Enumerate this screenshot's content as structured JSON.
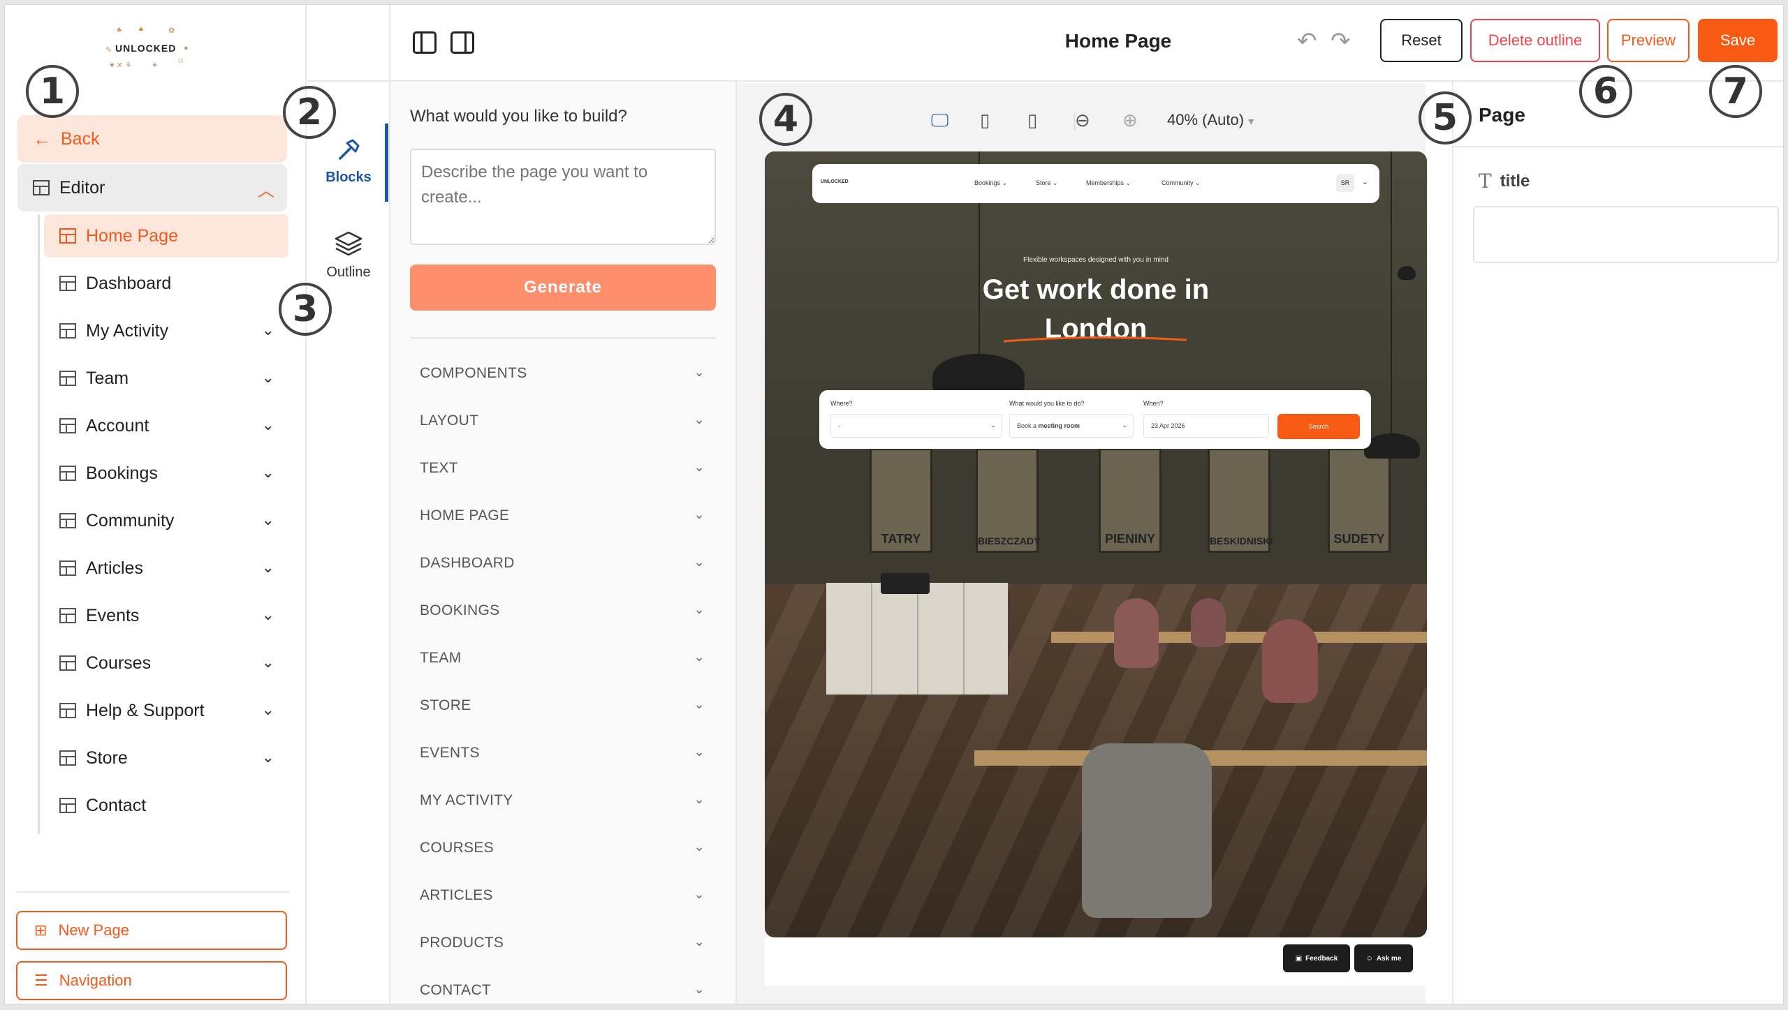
{
  "logo": {
    "text": "UNLOCKED"
  },
  "sidebar": {
    "back_label": "Back",
    "editor_label": "Editor",
    "items": [
      {
        "label": "Home Page",
        "active": true,
        "expandable": false
      },
      {
        "label": "Dashboard",
        "active": false,
        "expandable": false
      },
      {
        "label": "My Activity",
        "active": false,
        "expandable": true
      },
      {
        "label": "Team",
        "active": false,
        "expandable": true
      },
      {
        "label": "Account",
        "active": false,
        "expandable": true
      },
      {
        "label": "Bookings",
        "active": false,
        "expandable": true
      },
      {
        "label": "Community",
        "active": false,
        "expandable": true
      },
      {
        "label": "Articles",
        "active": false,
        "expandable": true
      },
      {
        "label": "Events",
        "active": false,
        "expandable": true
      },
      {
        "label": "Courses",
        "active": false,
        "expandable": true
      },
      {
        "label": "Help & Support",
        "active": false,
        "expandable": true
      },
      {
        "label": "Store",
        "active": false,
        "expandable": true
      },
      {
        "label": "Contact",
        "active": false,
        "expandable": false
      }
    ],
    "new_page_label": "New Page",
    "navigation_label": "Navigation"
  },
  "rail": {
    "blocks_label": "Blocks",
    "outline_label": "Outline"
  },
  "topbar": {
    "title": "Home Page",
    "reset_label": "Reset",
    "delete_outline_label": "Delete outline",
    "preview_label": "Preview",
    "save_label": "Save"
  },
  "blocks_panel": {
    "prompt_title": "What would you like to build?",
    "textarea_placeholder": "Describe the page you want to create...",
    "generate_label": "Generate",
    "categories": [
      "COMPONENTS",
      "LAYOUT",
      "TEXT",
      "HOME PAGE",
      "DASHBOARD",
      "BOOKINGS",
      "TEAM",
      "STORE",
      "EVENTS",
      "MY ACTIVITY",
      "COURSES",
      "ARTICLES",
      "PRODUCTS",
      "CONTACT"
    ]
  },
  "canvas": {
    "zoom_label": "40% (Auto)",
    "site": {
      "logo": "UNLOCKED",
      "nav": [
        "Bookings",
        "Store",
        "Memberships",
        "Community"
      ],
      "avatar": "SR",
      "hero_subtitle": "Flexible workspaces designed with you in mind",
      "hero_line1": "Get work done in",
      "hero_line2": "London",
      "search": {
        "where_label": "Where?",
        "where_value": "-",
        "what_label": "What would you like to do?",
        "what_value_prefix": "Book a",
        "what_value_bold": "meeting room",
        "when_label": "When?",
        "when_value": "23 Apr 2026",
        "button": "Search"
      },
      "posters": [
        "TATRY",
        "BIESZCZADY",
        "PIENINY",
        "BESKIDNISKI",
        "SUDETY"
      ],
      "feedback_label": "Feedback",
      "ask_label": "Ask me"
    }
  },
  "props": {
    "title": "Page",
    "field_label": "title",
    "field_value": ""
  },
  "annotations": [
    "1",
    "2",
    "3",
    "4",
    "5",
    "6",
    "7"
  ],
  "colors": {
    "accent": "#f25a1c",
    "danger": "#e8474d",
    "rail_active": "#1b55a8",
    "generate": "#fd8f6c"
  }
}
